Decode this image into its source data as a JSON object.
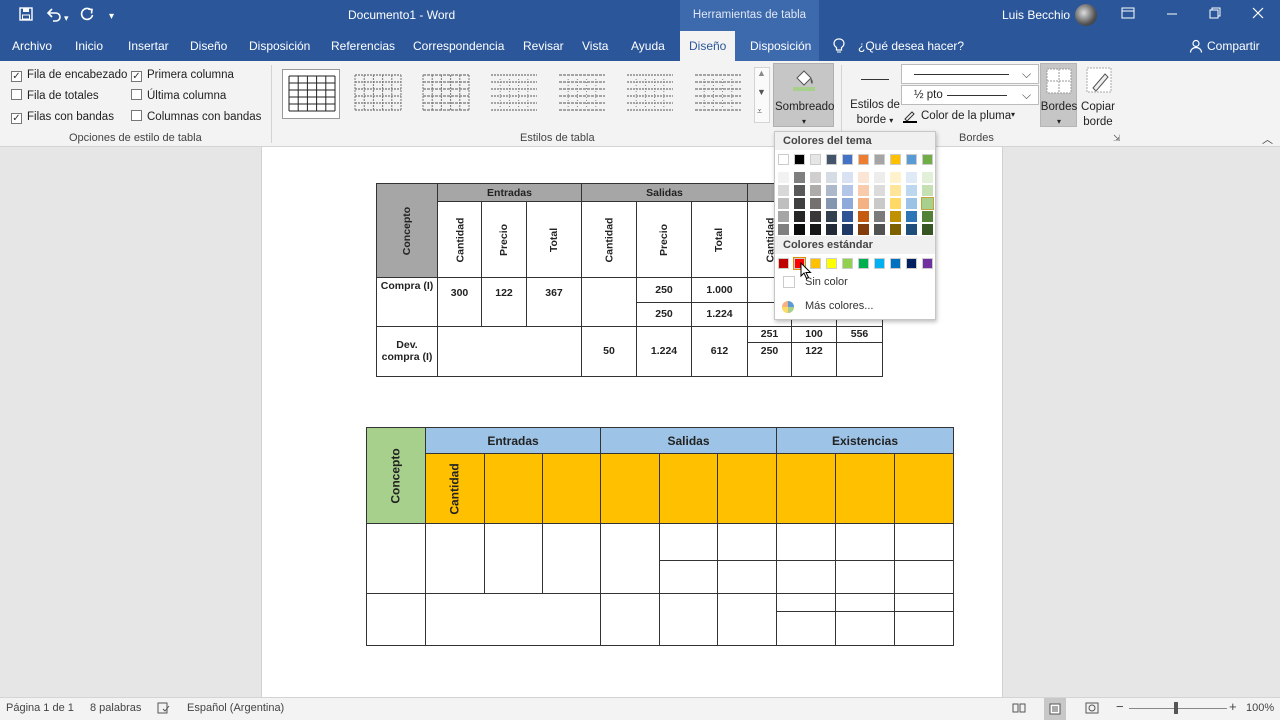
{
  "titlebar": {
    "doc_title": "Documento1 - Word",
    "context_title": "Herramientas de tabla",
    "user": "Luis Becchio"
  },
  "tabs": [
    "Archivo",
    "Inicio",
    "Insertar",
    "Diseño",
    "Disposición",
    "Referencias",
    "Correspondencia",
    "Revisar",
    "Vista",
    "Ayuda"
  ],
  "context_tabs": {
    "design": "Diseño",
    "layout": "Disposición"
  },
  "tellme": "¿Qué desea hacer?",
  "share": "Compartir",
  "ribbon": {
    "style_options": {
      "items": [
        {
          "label": "Fila de encabezado",
          "checked": true
        },
        {
          "label": "Fila de totales",
          "checked": false
        },
        {
          "label": "Filas con bandas",
          "checked": true
        },
        {
          "label": "Primera columna",
          "checked": true
        },
        {
          "label": "Última columna",
          "checked": false
        },
        {
          "label": "Columnas con bandas",
          "checked": false
        }
      ],
      "group_label": "Opciones de estilo de tabla"
    },
    "table_styles_label": "Estilos de tabla",
    "shading_label": "Sombreado",
    "border_styles_label_1": "Estilos de",
    "border_styles_label_2": "borde",
    "pen_weight": "½ pto",
    "pen_color_label": "Color de la pluma",
    "borders_label": "Bordes",
    "copy_border_1": "Copiar",
    "copy_border_2": "borde",
    "borders_group_label": "Bordes"
  },
  "shading_menu": {
    "theme_colors_label": "Colores del tema",
    "standard_colors_label": "Colores estándar",
    "no_color": "Sin color",
    "more_colors": "Más colores...",
    "theme_top": [
      "#ffffff",
      "#000000",
      "#e7e6e6",
      "#44546a",
      "#4472c4",
      "#ed7d31",
      "#a5a5a5",
      "#ffc000",
      "#5b9bd5",
      "#70ad47"
    ],
    "theme_shades": [
      [
        "#f2f2f2",
        "#7f7f7f",
        "#d0cece",
        "#d6dce4",
        "#d9e2f3",
        "#fbe5d5",
        "#ededed",
        "#fff2cc",
        "#deebf6",
        "#e2efd9"
      ],
      [
        "#d8d8d8",
        "#595959",
        "#aeabab",
        "#adb9ca",
        "#b4c6e7",
        "#f7cbac",
        "#dbdbdb",
        "#fee599",
        "#bdd7ee",
        "#c5e0b3"
      ],
      [
        "#bfbfbf",
        "#3f3f3f",
        "#757070",
        "#8496b0",
        "#8eaadb",
        "#f4b183",
        "#c9c9c9",
        "#ffd965",
        "#9cc3e5",
        "#a8d08d"
      ],
      [
        "#a5a5a5",
        "#262626",
        "#3a3838",
        "#323f4f",
        "#2f5496",
        "#c55a11",
        "#7b7b7b",
        "#bf9000",
        "#2e75b5",
        "#538135"
      ],
      [
        "#7f7f7f",
        "#0c0c0c",
        "#171616",
        "#222a35",
        "#1f3864",
        "#833c0b",
        "#525252",
        "#7f6000",
        "#1e4e79",
        "#375623"
      ]
    ],
    "standard": [
      "#c00000",
      "#ff0000",
      "#ffc000",
      "#ffff00",
      "#92d050",
      "#00b050",
      "#00b0f0",
      "#0070c0",
      "#002060",
      "#7030a0"
    ]
  },
  "table1": {
    "headers": {
      "entradas": "Entradas",
      "salidas": "Salidas"
    },
    "cols": [
      "Concepto",
      "Cantidad",
      "Precio",
      "Total",
      "Cantidad",
      "Precio",
      "Total",
      "Cantidad"
    ],
    "row1": {
      "concepto": "Compra (I)",
      "cant": "300",
      "precio": "122",
      "total": "367",
      "s_precio_a": "250",
      "s_total_a": "1.000",
      "s_precio_b": "250",
      "s_total_b": "1.224"
    },
    "row2": {
      "concepto": "Dev. compra (I)",
      "s_cant": "50",
      "s_precio": "1.224",
      "s_total": "612",
      "e_cant_a": "251",
      "e_cant_b": "250",
      "e_precio_a": "100",
      "e_precio_b": "122",
      "e_total": "556"
    }
  },
  "table2": {
    "headers": {
      "concepto": "Concepto",
      "entradas": "Entradas",
      "salidas": "Salidas",
      "existencias": "Existencias",
      "cantidad": "Cantidad"
    }
  },
  "status": {
    "page": "Página 1 de 1",
    "words": "8 palabras",
    "language": "Español (Argentina)",
    "zoom": "100%"
  }
}
